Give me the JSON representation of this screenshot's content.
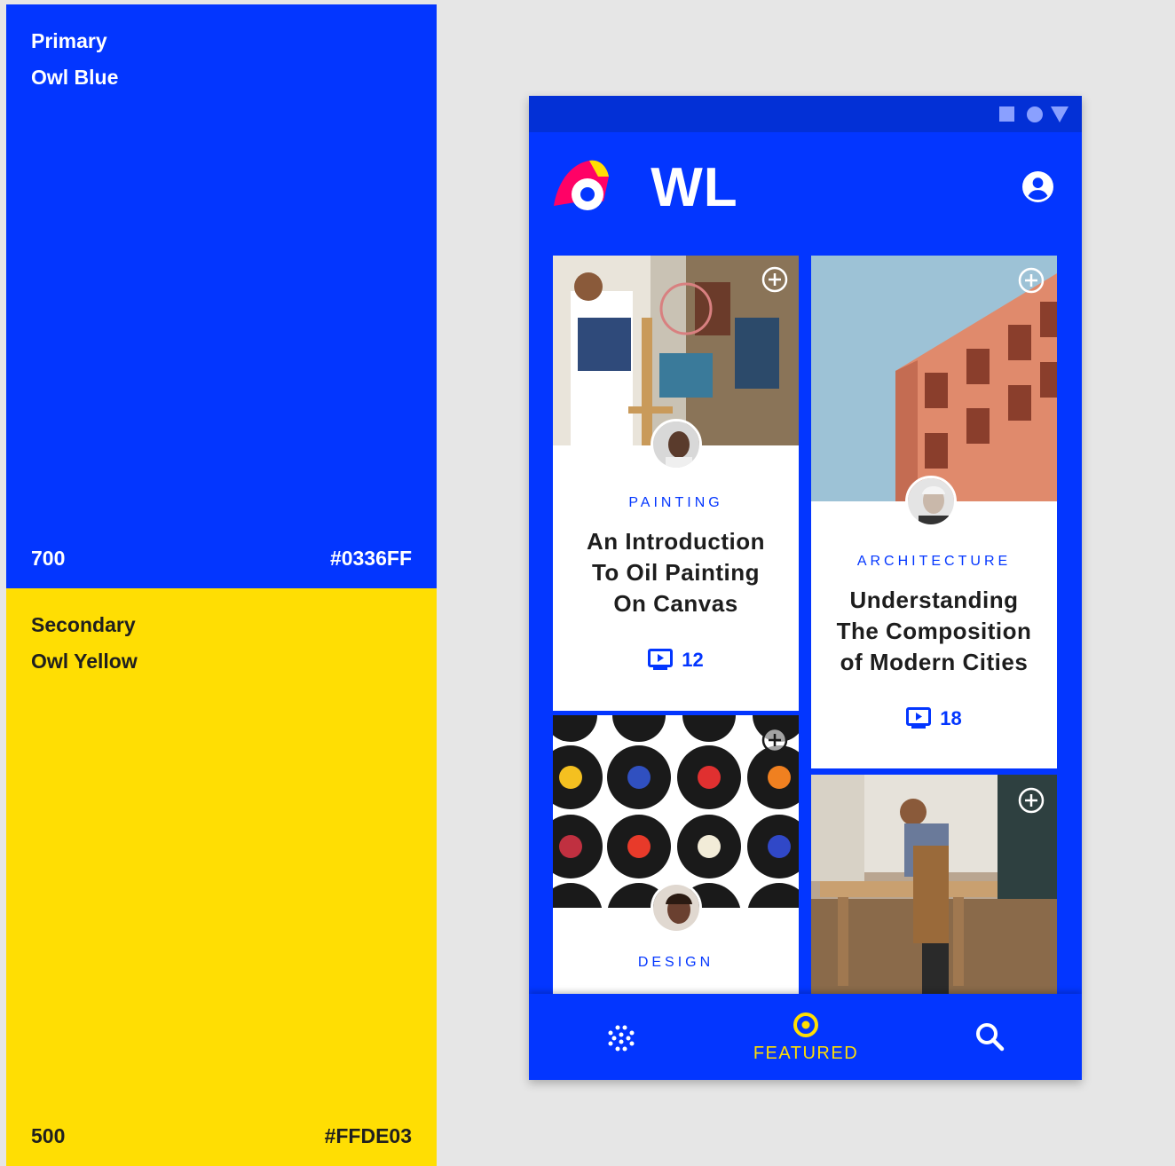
{
  "colors": {
    "primary": "#0336FF",
    "secondary": "#FFDE03",
    "status_bar": "#0330d6",
    "accent_red": "#FF0266"
  },
  "primary_swatch": {
    "label": "Primary",
    "name": "Owl Blue",
    "shade": "700",
    "hex": "#0336FF"
  },
  "secondary_swatch": {
    "label": "Secondary",
    "name": "Owl Yellow",
    "shade": "500",
    "hex": "#FFDE03"
  },
  "phone": {
    "status_bar": {
      "icons": [
        "square-icon",
        "circle-icon",
        "triangle-icon"
      ]
    },
    "app_bar": {
      "logo_text": "OWL",
      "account_icon": "account-circle-icon"
    },
    "cards": [
      {
        "category": "PAINTING",
        "title_lines": [
          "An Introduction",
          "To Oil Painting",
          "On Canvas"
        ],
        "lesson_count": "12",
        "image": "painting-photo"
      },
      {
        "category": "ARCHITECTURE",
        "title_lines": [
          "Understanding",
          "The Composition",
          "of Modern Cities"
        ],
        "lesson_count": "18",
        "image": "architecture-photo"
      },
      {
        "category": "DESIGN",
        "image": "vinyl-records-photo"
      },
      {
        "image": "woodworking-photo"
      }
    ],
    "bottom_nav": {
      "items": [
        {
          "icon": "dots-grid-icon",
          "label": ""
        },
        {
          "icon": "featured-target-icon",
          "label": "FEATURED",
          "selected": true
        },
        {
          "icon": "search-icon",
          "label": ""
        }
      ]
    }
  }
}
